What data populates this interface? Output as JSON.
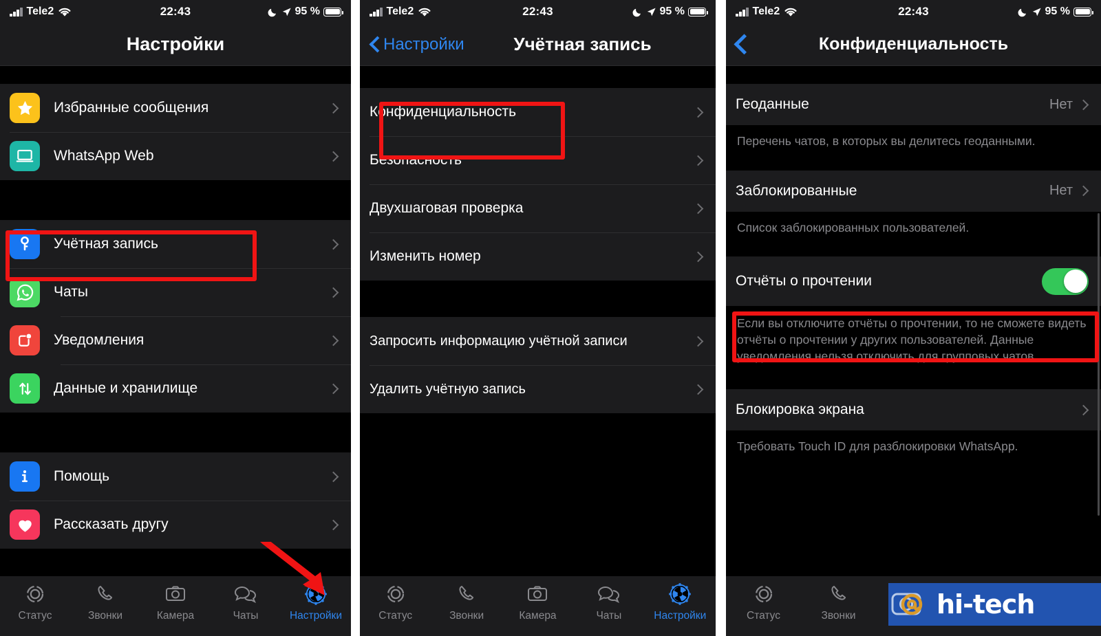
{
  "status_bar": {
    "carrier": "Tele2",
    "time": "22:43",
    "battery_percent": "95 %",
    "signal_icon": "cellular-bars-icon",
    "wifi_icon": "wifi-icon",
    "dnd_icon": "moon-icon",
    "location_icon": "location-arrow-icon",
    "battery_icon": "battery-icon"
  },
  "panel1": {
    "title": "Настройки",
    "sections": [
      {
        "rows": [
          {
            "label": "Избранные сообщения",
            "icon": "star-icon",
            "icon_bg": "#fcc21b",
            "chevron": true
          },
          {
            "label": "WhatsApp Web",
            "icon": "laptop-icon",
            "icon_bg": "#1eb6a6",
            "chevron": true
          }
        ]
      },
      {
        "rows": [
          {
            "label": "Учётная запись",
            "icon": "key-icon",
            "icon_bg": "#1877f2",
            "chevron": true,
            "highlighted": true
          },
          {
            "label": "Чаты",
            "icon": "whatsapp-icon",
            "icon_bg": "#4cd964",
            "chevron": true
          },
          {
            "label": "Уведомления",
            "icon": "notification-icon",
            "icon_bg": "#f0453c",
            "chevron": true
          },
          {
            "label": "Данные и хранилище",
            "icon": "data-transfer-icon",
            "icon_bg": "#3bd45f",
            "chevron": true
          }
        ]
      },
      {
        "rows": [
          {
            "label": "Помощь",
            "icon": "info-icon",
            "icon_bg": "#1877f2",
            "chevron": true
          },
          {
            "label": "Рассказать другу",
            "icon": "heart-icon",
            "icon_bg": "#f6365c",
            "chevron": true
          }
        ]
      }
    ]
  },
  "panel2": {
    "back_label": "Настройки",
    "title": "Учётная запись",
    "sections": [
      {
        "rows": [
          {
            "label": "Конфиденциальность",
            "chevron": true,
            "highlighted": true
          },
          {
            "label": "Безопасность",
            "chevron": true
          },
          {
            "label": "Двухшаговая проверка",
            "chevron": true
          },
          {
            "label": "Изменить номер",
            "chevron": true
          }
        ]
      },
      {
        "rows": [
          {
            "label": "Запросить информацию учётной записи",
            "chevron": true
          },
          {
            "label": "Удалить учётную запись",
            "chevron": true
          }
        ]
      }
    ]
  },
  "panel3": {
    "title": "Конфиденциальность",
    "back_icon": "chevron-left-icon",
    "sections": [
      {
        "rows": [
          {
            "label": "Геоданные",
            "value": "Нет",
            "chevron": true
          }
        ],
        "footnote": "Перечень чатов, в которых вы делитесь геоданными."
      },
      {
        "rows": [
          {
            "label": "Заблокированные",
            "value": "Нет",
            "chevron": true
          }
        ],
        "footnote": "Список заблокированных пользователей."
      },
      {
        "rows": [
          {
            "label": "Отчёты о прочтении",
            "toggle": true,
            "toggle_on": true,
            "highlighted": true
          }
        ],
        "footnote": "Если вы отключите отчёты о прочтении, то не сможете видеть отчёты о прочтении у других пользователей. Данные уведомления нельзя отключить для групповых чатов."
      },
      {
        "rows": [
          {
            "label": "Блокировка экрана",
            "chevron": true
          }
        ],
        "footnote": "Требовать Touch ID для разблокировки WhatsApp."
      }
    ]
  },
  "tabbar": {
    "items": [
      {
        "label": "Статус",
        "icon": "status-ring-icon",
        "active": false
      },
      {
        "label": "Звонки",
        "icon": "phone-icon",
        "active": false
      },
      {
        "label": "Камера",
        "icon": "camera-icon",
        "active": false
      },
      {
        "label": "Чаты",
        "icon": "chat-bubbles-icon",
        "active": false
      },
      {
        "label": "Настройки",
        "icon": "gear-icon",
        "active": true
      }
    ]
  },
  "annotations": {
    "highlight_color": "#f01414",
    "arrow_color": "#f01414",
    "arrow_target": "Настройки tab"
  },
  "watermark": {
    "text": "hi-tech",
    "logo_icon": "at-sign-icon",
    "bg_color": "#2254b0",
    "logo_color": "#d99a2b"
  }
}
